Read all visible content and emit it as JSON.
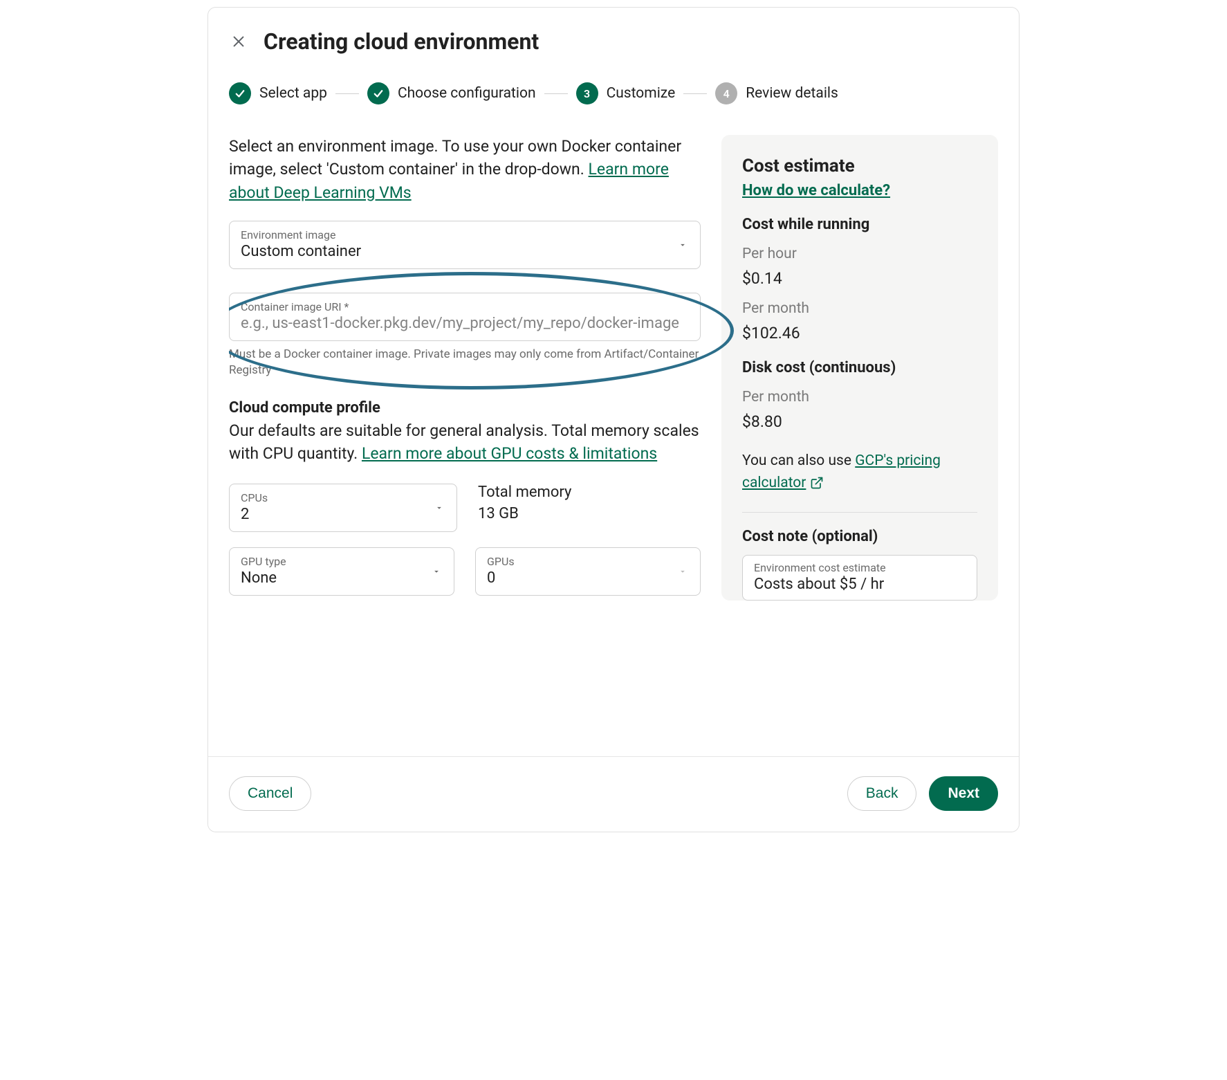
{
  "header": {
    "title": "Creating cloud environment"
  },
  "stepper": {
    "steps": [
      {
        "label": "Select app",
        "state": "done"
      },
      {
        "label": "Choose configuration",
        "state": "done"
      },
      {
        "label": "Customize",
        "num": "3",
        "state": "active"
      },
      {
        "label": "Review details",
        "num": "4",
        "state": "future"
      }
    ]
  },
  "intro": {
    "text_a": "Select an environment image. To use your own Docker container image, select 'Custom container' in the drop-down. ",
    "link": "Learn more about Deep Learning VMs"
  },
  "env_image": {
    "label": "Environment image",
    "value": "Custom container"
  },
  "container_uri": {
    "label": "Container image URI *",
    "placeholder": "e.g., us-east1-docker.pkg.dev/my_project/my_repo/docker-image",
    "help": "Must be a Docker container image. Private images may only come from Artifact/Container Registry"
  },
  "profile": {
    "heading": "Cloud compute profile",
    "sub_a": "Our defaults are suitable for general analysis. Total memory scales with CPU quantity. ",
    "sub_link": "Learn more about GPU costs & limitations",
    "cpus": {
      "label": "CPUs",
      "value": "2"
    },
    "memory": {
      "label": "Total memory",
      "value": "13 GB"
    },
    "gpu_type": {
      "label": "GPU type",
      "value": "None"
    },
    "gpus": {
      "label": "GPUs",
      "value": "0"
    }
  },
  "cost": {
    "title": "Cost estimate",
    "how_link": "How do we calculate?",
    "running_h": "Cost while running",
    "per_hour_l": "Per hour",
    "per_hour_v": "$0.14",
    "per_month_l": "Per month",
    "per_month_v": "$102.46",
    "disk_h": "Disk cost (continuous)",
    "disk_pm_l": "Per month",
    "disk_pm_v": "$8.80",
    "note_a": "You can also use ",
    "note_link": "GCP's pricing calculator",
    "cost_note_h": "Cost note (optional)",
    "cost_note_field_label": "Environment cost estimate",
    "cost_note_value": "Costs about $5 / hr"
  },
  "footer": {
    "cancel": "Cancel",
    "back": "Back",
    "next": "Next"
  }
}
